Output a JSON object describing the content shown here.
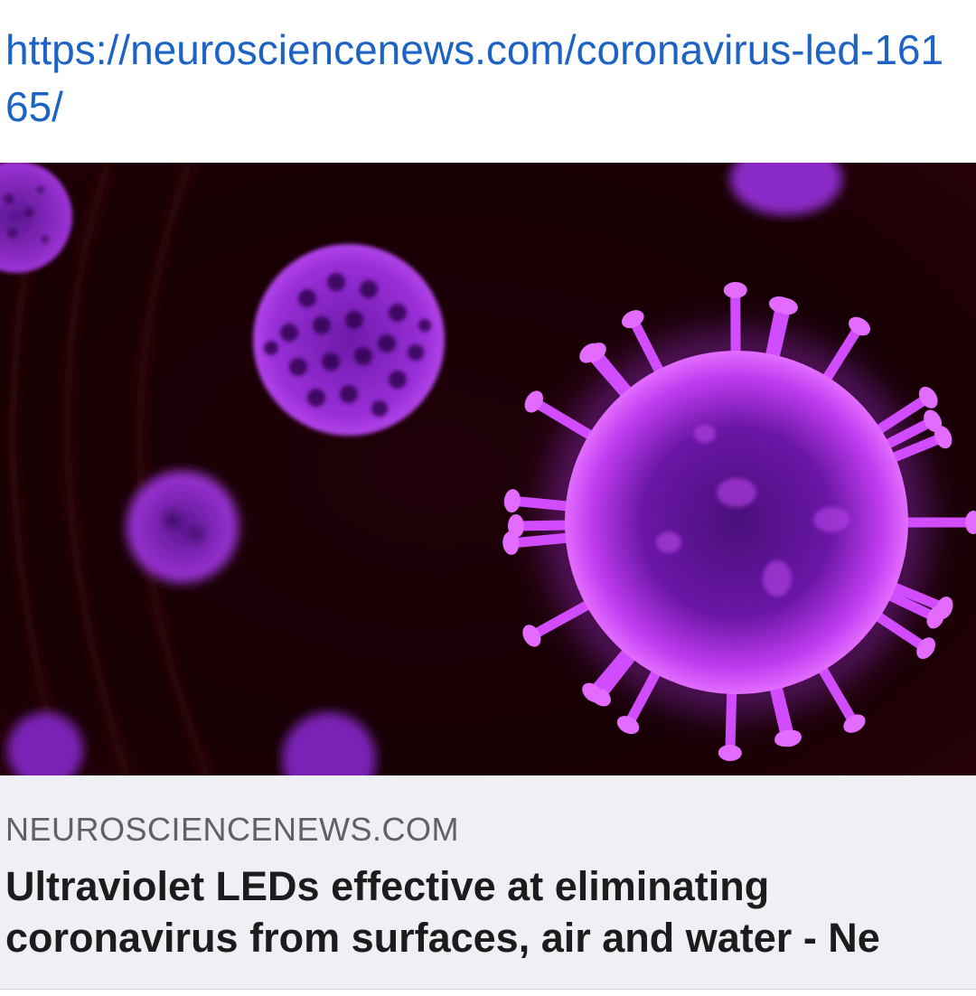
{
  "link": {
    "url": "https://neurosciencenews.com/coronavirus-led-16165/"
  },
  "preview": {
    "image_icon": "coronavirus-image",
    "domain": "NEUROSCIENCENEWS.COM",
    "headline_line1": "Ultraviolet LEDs effective at eliminating",
    "headline_line2": "coronavirus from surfaces, air and water - Ne"
  },
  "colors": {
    "link": "#1d63c6",
    "caption_bg": "#eff0f3",
    "virus_glow": "#d24cff",
    "background": "#180006"
  }
}
